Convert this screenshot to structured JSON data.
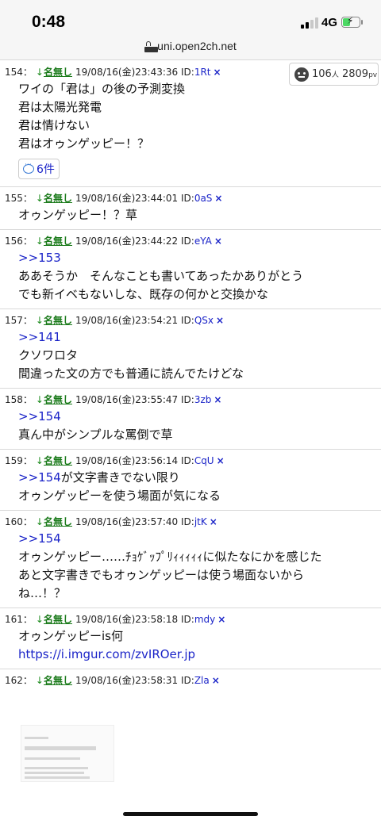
{
  "status": {
    "time": "0:48",
    "network": "4G"
  },
  "browser": {
    "url": "uni.open2ch.net"
  },
  "stats": {
    "people": "106",
    "people_unit": "人",
    "pv": "2809",
    "pv_unit": "pv"
  },
  "posts": [
    {
      "num": "154",
      "date": "19/08/16(金)23:43:36",
      "id": "1Rt",
      "lines": [
        "ワイの「君は」の後の予測変換",
        "君は太陽光発電",
        "君は情けない",
        "君はオゥンゲッピー！？"
      ],
      "reply_count": "6件"
    },
    {
      "num": "155",
      "date": "19/08/16(金)23:44:01",
      "id": "0aS",
      "lines": [
        "オゥンゲッピー！？草"
      ]
    },
    {
      "num": "156",
      "date": "19/08/16(金)23:44:22",
      "id": "eYA",
      "anchor": ">>153",
      "lines": [
        "ああそうか　そんなことも書いてあったかありがとう",
        "でも新イベもないしな、既存の何かと交換かな"
      ]
    },
    {
      "num": "157",
      "date": "19/08/16(金)23:54:21",
      "id": "QSx",
      "anchor": ">>141",
      "lines": [
        "クソワロタ",
        "間違った文の方でも普通に読んでたけどな"
      ]
    },
    {
      "num": "158",
      "date": "19/08/16(金)23:55:47",
      "id": "3zb",
      "anchor": ">>154",
      "lines": [
        "真ん中がシンプルな罵倒で草"
      ]
    },
    {
      "num": "159",
      "date": "19/08/16(金)23:56:14",
      "id": "CqU",
      "anchor": ">>154",
      "anchor_tail": "が文字書きでない限り",
      "lines": [
        "オゥンゲッピーを使う場面が気になる"
      ]
    },
    {
      "num": "160",
      "date": "19/08/16(金)23:57:40",
      "id": "jtK",
      "anchor": ">>154",
      "lines": [
        "オゥンゲッピー……ﾁｮｹﾞｯﾌﾟﾘｨｨｨｨｨに似たなにかを感じた",
        "あと文字書きでもオゥンゲッピーは使う場面ないから",
        "ね…！？"
      ]
    },
    {
      "num": "161",
      "date": "19/08/16(金)23:58:18",
      "id": "mdy",
      "lines": [
        "オゥンゲッピーis何"
      ],
      "link": "https://i.imgur.com/zvIROer.jp"
    },
    {
      "num": "162",
      "date": "19/08/16(金)23:58:31",
      "id": "Zla"
    }
  ],
  "common": {
    "arrow": "↓",
    "name": "名無し",
    "id_prefix": "ID:",
    "close": "×",
    "sep": "："
  },
  "colors": {
    "link": "#1b24c8",
    "name": "#1a7a1a",
    "status_bg": "#f6f6f6"
  }
}
